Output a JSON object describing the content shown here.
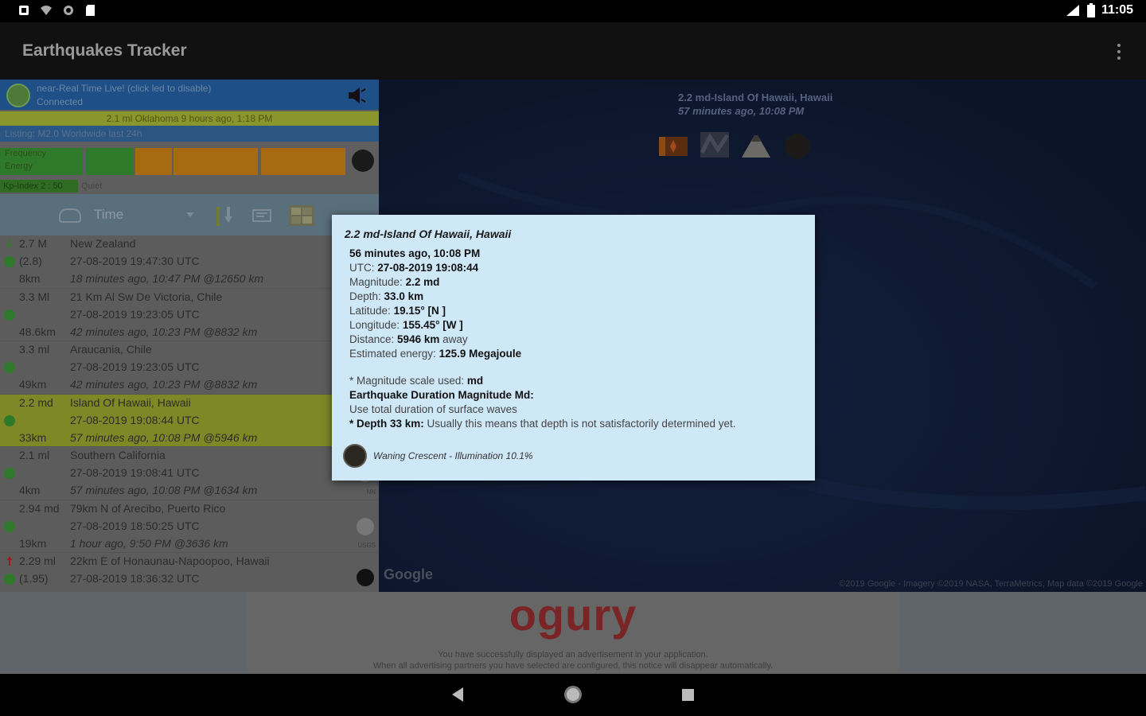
{
  "status_bar": {
    "time": "11:05"
  },
  "app_bar": {
    "title": "Earthquakes Tracker",
    "overflow_icon": "more-vert-icon"
  },
  "realtime": {
    "line1": "near-Real Time Live! (click led to disable)",
    "line2": "Connected",
    "last_event": "2.1 ml Oklahoma 9 hours ago, 1:18 PM",
    "listing": "Listing: M2.0 Worldwide last 24h"
  },
  "frequency": {
    "label1": "Frequency",
    "label2": "Energy"
  },
  "kp": {
    "index": "Kp-Index 2 : 50",
    "state": "Quiet"
  },
  "toolbar": {
    "sort_label": "Time"
  },
  "earthquakes": [
    {
      "mag": "2.7 M",
      "place": "New Zealand",
      "mag2": "(2.8)",
      "utc": "27-08-2019 19:47:30 UTC",
      "depth": "8km",
      "ago": "18 minutes ago, 10:47 PM @12650 km",
      "arrow": "down",
      "highlight": false
    },
    {
      "mag": "3.3 Ml",
      "place": "21 Km Al Sw De Victoria, Chile",
      "mag2": "",
      "utc": "27-08-2019 19:23:05 UTC",
      "depth": "48.6km",
      "ago": "42 minutes ago, 10:23 PM @8832 km",
      "arrow": "",
      "highlight": false
    },
    {
      "mag": "3.3 ml",
      "place": "Araucania, Chile",
      "mag2": "",
      "utc": "27-08-2019 19:23:05 UTC",
      "depth": "49km",
      "ago": "42 minutes ago, 10:23 PM @8832 km",
      "arrow": "",
      "highlight": false
    },
    {
      "mag": "2.2 md",
      "place": "Island Of Hawaii, Hawaii",
      "mag2": "",
      "utc": "27-08-2019 19:08:44 UTC",
      "depth": "33km",
      "ago": "57 minutes ago, 10:08 PM @5946 km",
      "arrow": "",
      "highlight": true
    },
    {
      "mag": "2.1 ml",
      "place": "Southern California",
      "mag2": "",
      "utc": "27-08-2019 19:08:41 UTC",
      "depth": "4km",
      "ago": "57 minutes ago, 10:08 PM @1634 km",
      "arrow": "",
      "highlight": false,
      "tiny": "NN"
    },
    {
      "mag": "2.94 md",
      "place": "79km N of Arecibo, Puerto Rico",
      "mag2": "",
      "utc": "27-08-2019 18:50:25 UTC",
      "depth": "19km",
      "ago": "1 hour ago, 9:50 PM @3636 km",
      "arrow": "",
      "highlight": false,
      "tiny": "USGS"
    },
    {
      "mag": "2.29 ml",
      "place": "22km E of Honaunau-Napoopoo, Hawaii",
      "mag2": "(1.95)",
      "utc": "27-08-2019 18:36:32 UTC",
      "depth": "",
      "ago": "",
      "arrow": "up",
      "highlight": false
    }
  ],
  "map": {
    "label_line1": "2.2 md-Island Of Hawaii, Hawaii",
    "label_line2": "57 minutes ago, 10:08 PM",
    "logo": "Google",
    "copyright": "©2019 Google - Imagery ©2019 NASA, TerraMetrics, Map data ©2019 Google"
  },
  "popup": {
    "title": "2.2 md-Island Of Hawaii, Hawaii",
    "ago": "56 minutes ago, 10:08 PM",
    "utc_label": "UTC:",
    "utc": "27-08-2019 19:08:44",
    "magnitude_label": "Magnitude:",
    "magnitude": "2.2 md",
    "depth_label": "Depth:",
    "depth": "33.0 km",
    "lat_label": "Latitude:",
    "lat": "19.15° [N ]",
    "lon_label": "Longitude:",
    "lon": "155.45° [W ]",
    "dist_label": "Distance:",
    "dist": "5946 km",
    "dist_suffix": "away",
    "energy_label": "Estimated energy:",
    "energy": "125.9 Megajoule",
    "scale_label": "* Magnitude scale used:",
    "scale": "md",
    "scale_name": "Earthquake Duration Magnitude Md:",
    "scale_desc": "Use total duration of surface waves",
    "depth_note_label": "* Depth 33 km:",
    "depth_note": "Usually this means that depth is not satisfactorily determined yet.",
    "moon": "Waning Crescent - Illumination 10.1%"
  },
  "ad": {
    "brand": "ogury",
    "note1": "You have successfully displayed an advertisement in your application.",
    "note2": "When all advertising partners you have selected are configured, this notice will disappear automatically."
  }
}
